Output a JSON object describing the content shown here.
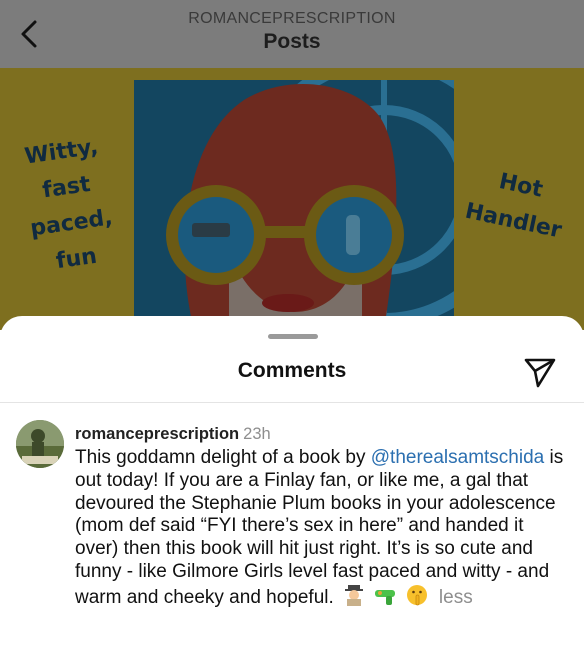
{
  "header": {
    "account": "ROMANCEPRESCRIPTION",
    "title": "Posts"
  },
  "post": {
    "left_text": [
      "Witty,",
      "fast",
      "paced,",
      "fun"
    ],
    "right_text": [
      "Hot",
      "Handler"
    ]
  },
  "comments_sheet": {
    "title": "Comments"
  },
  "comment": {
    "username": "romanceprescription",
    "time": "23h",
    "text_before": "This goddamn delight of a book by",
    "mention": "@therealsamtschida",
    "text_after": " is out today! If you are a Finlay fan, or like me, a gal that devoured the Stephanie Plum books in your adolescence (mom def said “FYI there’s sex in here” and handed it over) then this book will hit just right. It’s is so cute and funny - like Gilmore Girls level fast paced and witty - and warm and cheeky and hopeful.",
    "emojis": [
      "detective-emoji",
      "water-pistol-emoji",
      "shushing-face-emoji"
    ],
    "less_label": "less"
  },
  "colors": {
    "mention": "#2b6fb0",
    "meta_gray": "#8e8e8e",
    "post_bg_yellow": "#f2d43a",
    "art_blue": "#2a8fc0",
    "hair_red": "#d8422a"
  }
}
